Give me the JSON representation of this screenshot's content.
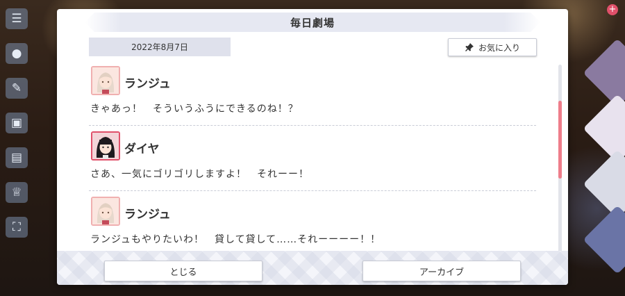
{
  "modal": {
    "title": "毎日劇場",
    "date": "2022年8月7日",
    "favorite_label": "お気に入り",
    "entries": [
      {
        "speaker": "ランジュ",
        "line": "きゃあっ！　そういうふうにできるのね！？",
        "avatar": "lanzhu-avatar"
      },
      {
        "speaker": "ダイヤ",
        "line": "さあ、一気にゴリゴリしますよ！　それーー！",
        "avatar": "dia-avatar"
      },
      {
        "speaker": "ランジュ",
        "line": "ランジュもやりたいわ！　貸して貸して……それーーーー！！",
        "avatar": "lanzhu-avatar"
      }
    ],
    "close_label": "とじる",
    "archive_label": "アーカイブ"
  },
  "colors": {
    "accent": "#ee7d8a",
    "title_bg": "#e6e8f2",
    "date_bg": "#dfe1ec"
  }
}
